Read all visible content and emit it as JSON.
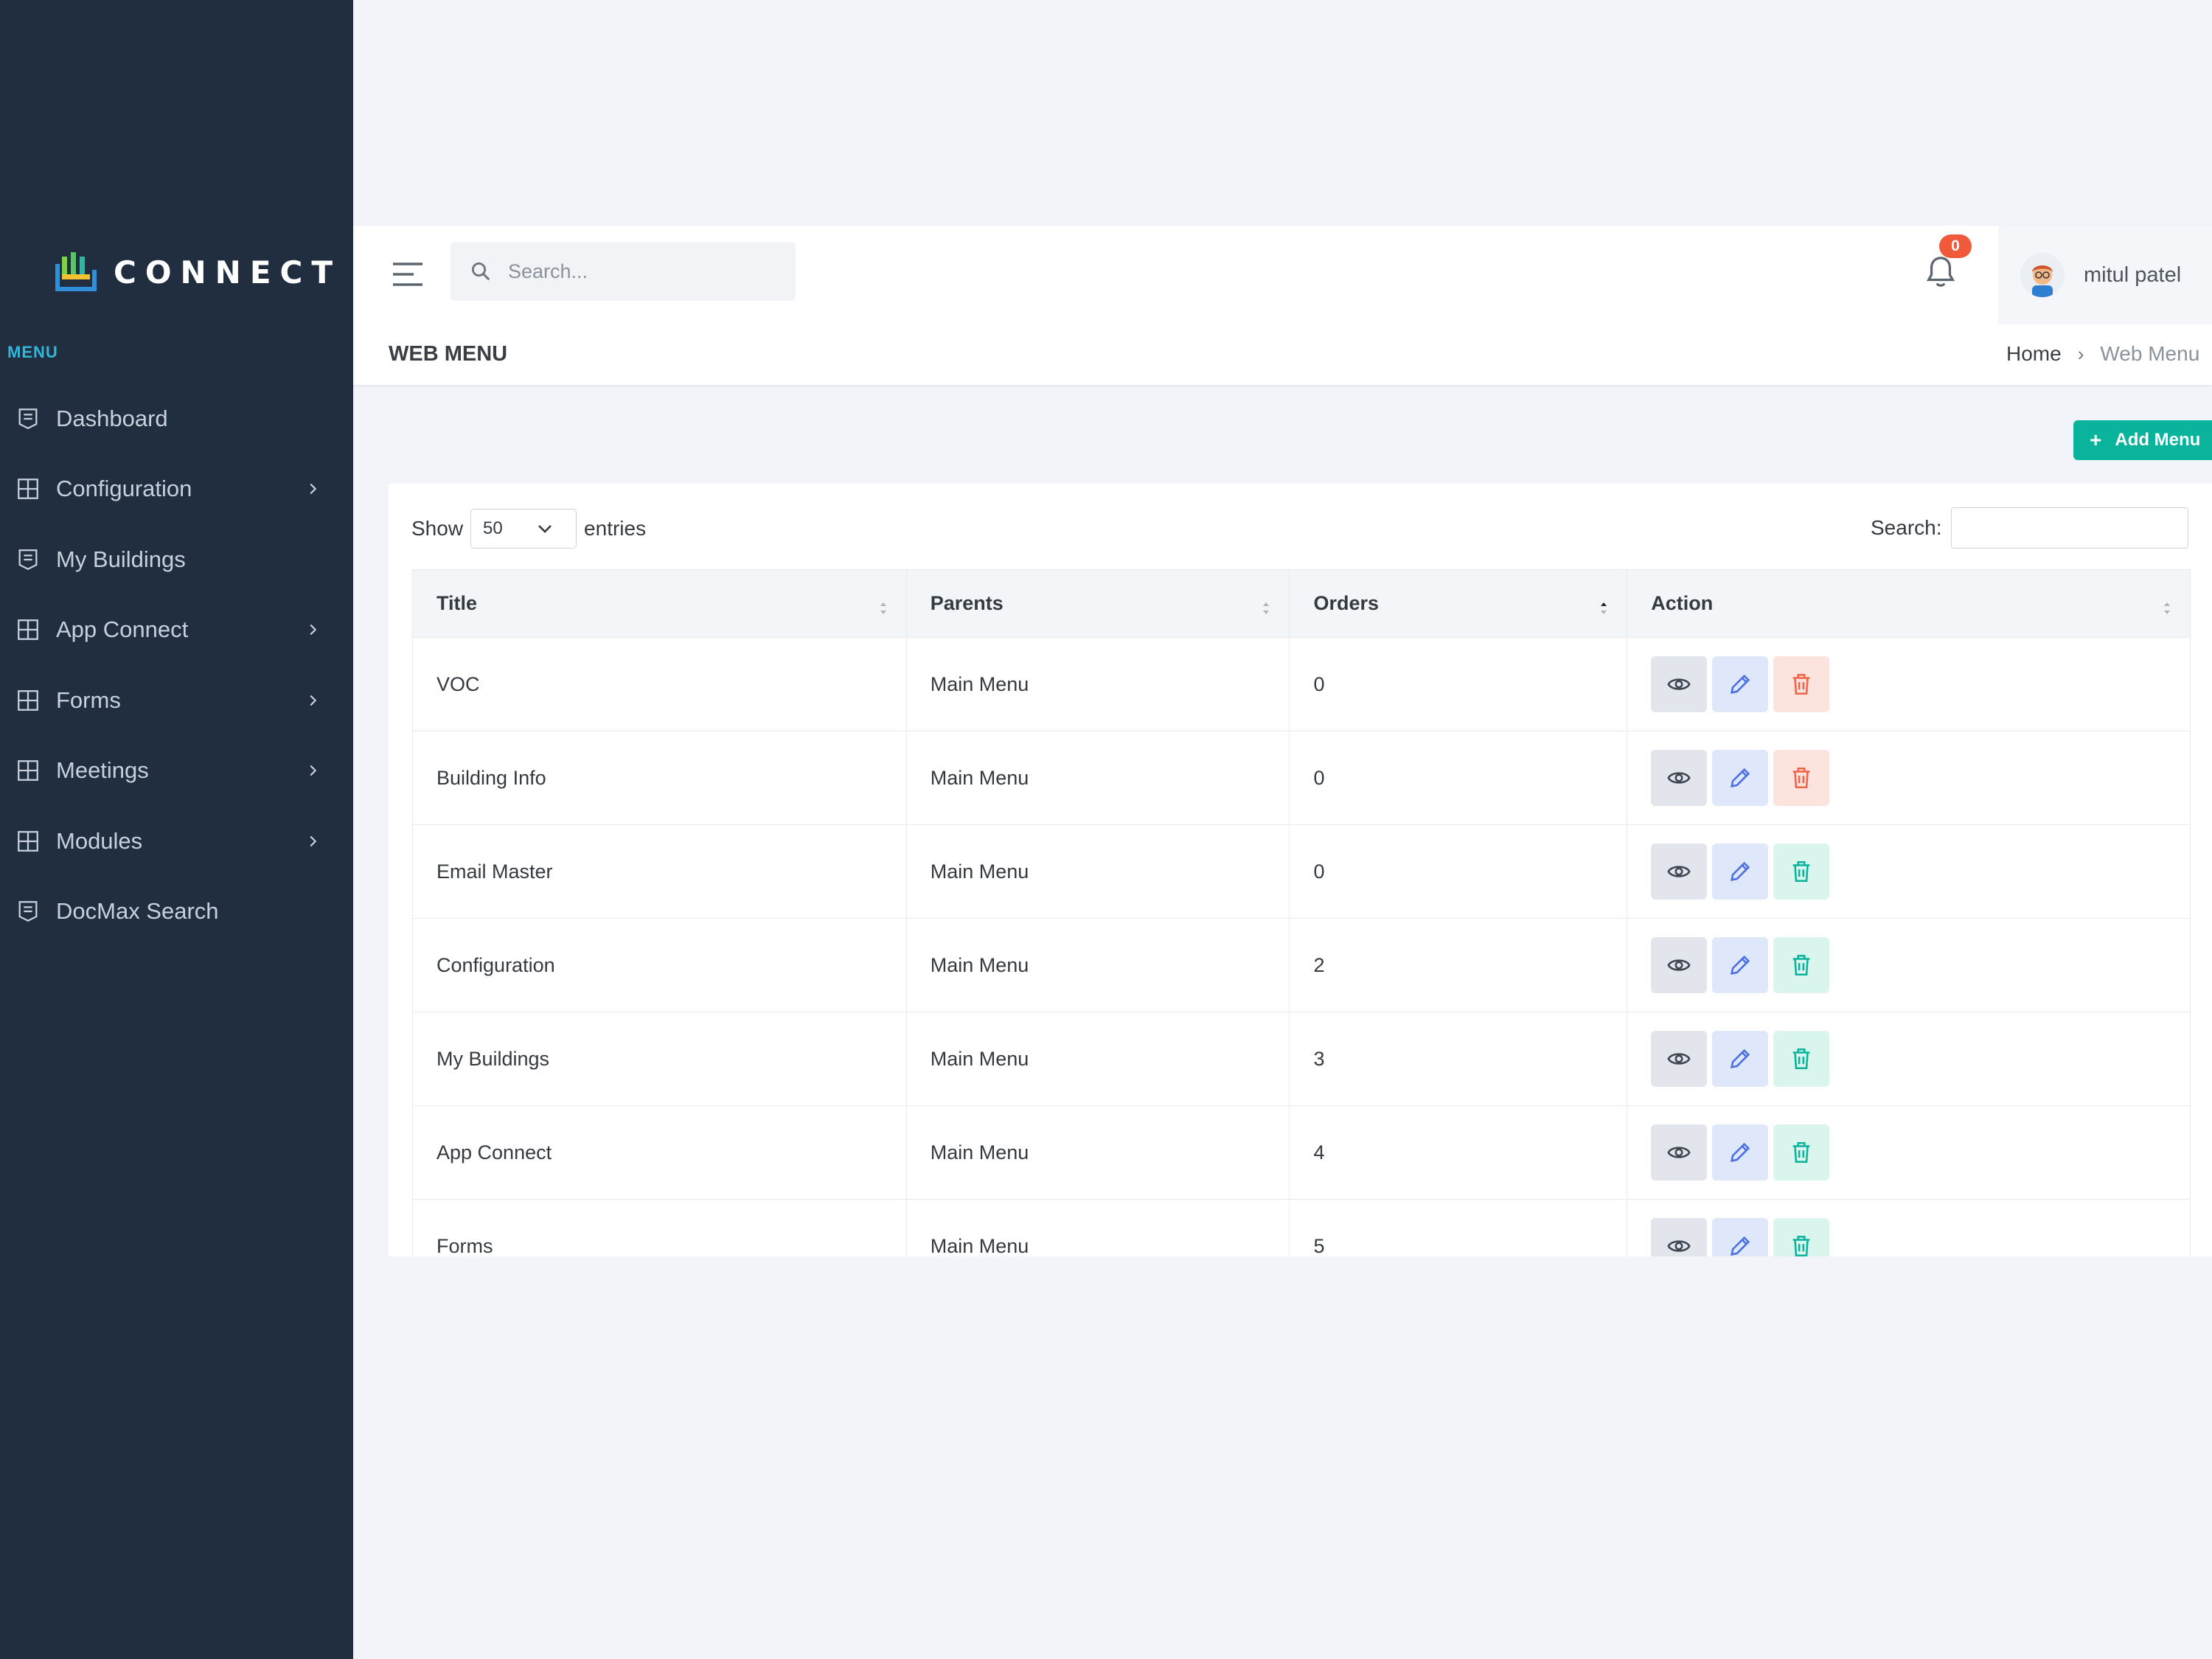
{
  "app": {
    "logo_text": "CONNECT"
  },
  "sidebar": {
    "menu_title": "MENU",
    "items": [
      {
        "label": "Dashboard",
        "icon": "list-shield-icon",
        "has_children": false
      },
      {
        "label": "Configuration",
        "icon": "grid-icon",
        "has_children": true
      },
      {
        "label": "My Buildings",
        "icon": "list-shield-icon",
        "has_children": false
      },
      {
        "label": "App Connect",
        "icon": "grid-icon",
        "has_children": true
      },
      {
        "label": "Forms",
        "icon": "grid-icon",
        "has_children": true
      },
      {
        "label": "Meetings",
        "icon": "grid-icon",
        "has_children": true
      },
      {
        "label": "Modules",
        "icon": "grid-icon",
        "has_children": true
      },
      {
        "label": "DocMax Search",
        "icon": "list-shield-icon",
        "has_children": false
      }
    ]
  },
  "topbar": {
    "search_placeholder": "Search...",
    "notification_count": "0",
    "user_name": "mitul patel"
  },
  "page": {
    "title": "WEB MENU",
    "breadcrumb": {
      "home": "Home",
      "separator": "›",
      "current": "Web Menu"
    },
    "add_button": {
      "icon": "+",
      "label": "Add Menu"
    }
  },
  "table_controls": {
    "show_label": "Show",
    "page_size": "50",
    "entries_label": "entries",
    "search_label": "Search:"
  },
  "table": {
    "columns": [
      "Title",
      "Parents",
      "Orders",
      "Action"
    ],
    "rows": [
      {
        "title": "VOC",
        "parent": "Main Menu",
        "order": "0",
        "delete_style": "red"
      },
      {
        "title": "Building Info",
        "parent": "Main Menu",
        "order": "0",
        "delete_style": "red"
      },
      {
        "title": "Email Master",
        "parent": "Main Menu",
        "order": "0",
        "delete_style": "green"
      },
      {
        "title": "Configuration",
        "parent": "Main Menu",
        "order": "2",
        "delete_style": "green"
      },
      {
        "title": "My Buildings",
        "parent": "Main Menu",
        "order": "3",
        "delete_style": "green"
      },
      {
        "title": "App Connect",
        "parent": "Main Menu",
        "order": "4",
        "delete_style": "green"
      },
      {
        "title": "Forms",
        "parent": "Main Menu",
        "order": "5",
        "delete_style": "green"
      }
    ]
  },
  "colors": {
    "sidebar_bg": "#212e40",
    "accent_green": "#0ab39c",
    "badge_red": "#f05a3b",
    "menu_title": "#30b7d9",
    "edit_blue": "#4a6fe3",
    "delete_red": "#f06548"
  }
}
